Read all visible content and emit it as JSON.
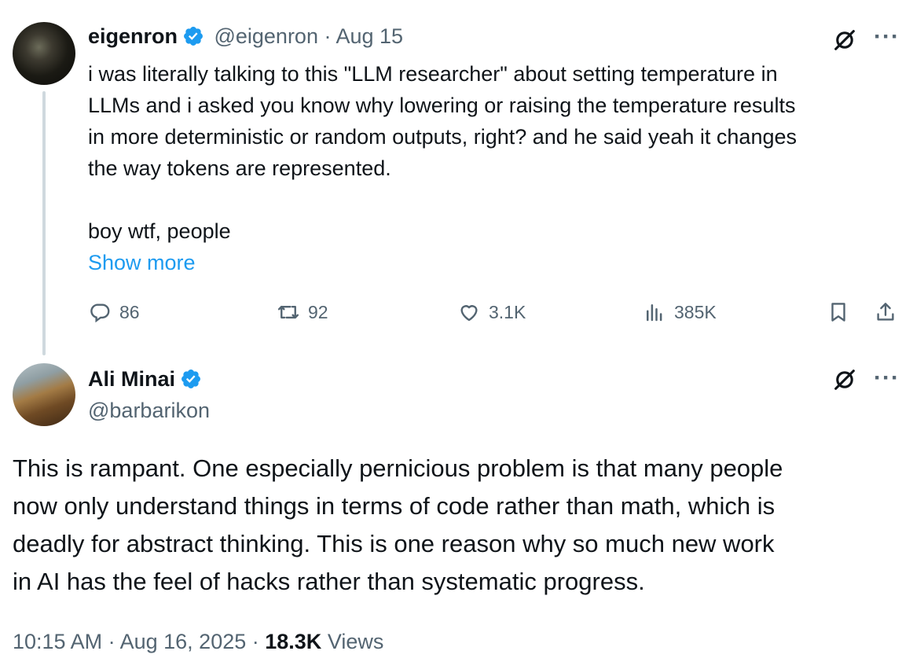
{
  "tweet1": {
    "name": "eigenron",
    "handle": "@eigenron",
    "separator": " · ",
    "date": "Aug 15",
    "text": "i was literally talking to this \"LLM researcher\" about setting temperature in\nLLMs and i asked you know why lowering or raising the temperature results\nin more deterministic or random outputs, right? and he said yeah it changes\nthe way tokens are represented.\n\nboy wtf, people",
    "show_more": "Show more",
    "replies": "86",
    "reposts": "92",
    "likes": "3.1K",
    "views": "385K"
  },
  "tweet2": {
    "name": "Ali Minai",
    "handle": "@barbarikon",
    "text": "This is rampant. One especially pernicious problem is that many people\nnow only understand things in terms of code rather than math, which is\ndeadly for abstract thinking. This is one reason why so much new work\nin AI has the feel of hacks rather than systematic progress.",
    "time": "10:15 AM",
    "sep": " · ",
    "date": "Aug 16, 2025",
    "views_count": "18.3K",
    "views_label": "Views"
  },
  "colors": {
    "verified": "#1d9bf0",
    "link": "#1d9bf0",
    "muted": "#536471"
  },
  "icons": [
    "verified-badge-icon",
    "grok-icon",
    "more-icon",
    "reply-icon",
    "repost-icon",
    "like-icon",
    "views-icon",
    "bookmark-icon",
    "share-icon"
  ]
}
